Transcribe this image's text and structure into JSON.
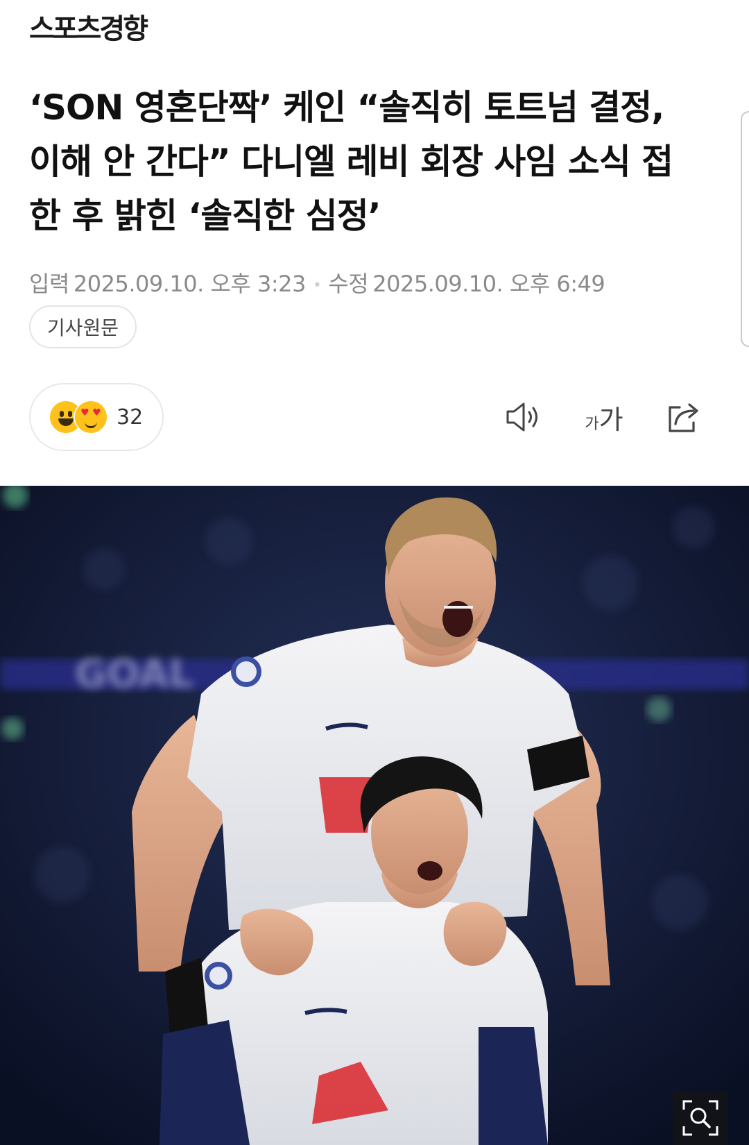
{
  "header": {
    "logo_text": "스포츠경향"
  },
  "article": {
    "title": "‘SON 영혼단짝’ 케인 “솔직히 토트넘 결정, 이해 안 간다” 다니엘 레비 회장 사임 소식 접한 후 밝힌 ‘솔직한 심정’",
    "published_label": "입력",
    "published": "2025.09.10. 오후 3:23",
    "modified_label": "수정",
    "modified": "2025.09.10. 오후 6:49",
    "source_button": "기사원문"
  },
  "reactions": {
    "count": "32",
    "emojis": [
      "grinning-face",
      "heart-eyes-face"
    ]
  },
  "toolbar": {
    "speaker_icon": "speaker-icon",
    "font_size_small": "가",
    "font_size_large": "가",
    "share_icon": "share-icon"
  },
  "photo": {
    "description_icon": "zoom-icon"
  },
  "colors": {
    "text": "#111111",
    "meta": "#8a8a8a",
    "border": "#e4e4e4",
    "emoji_yellow": "#ffc21a",
    "photo_bg": "#0f1730",
    "spurs_navy": "#1b2656"
  }
}
